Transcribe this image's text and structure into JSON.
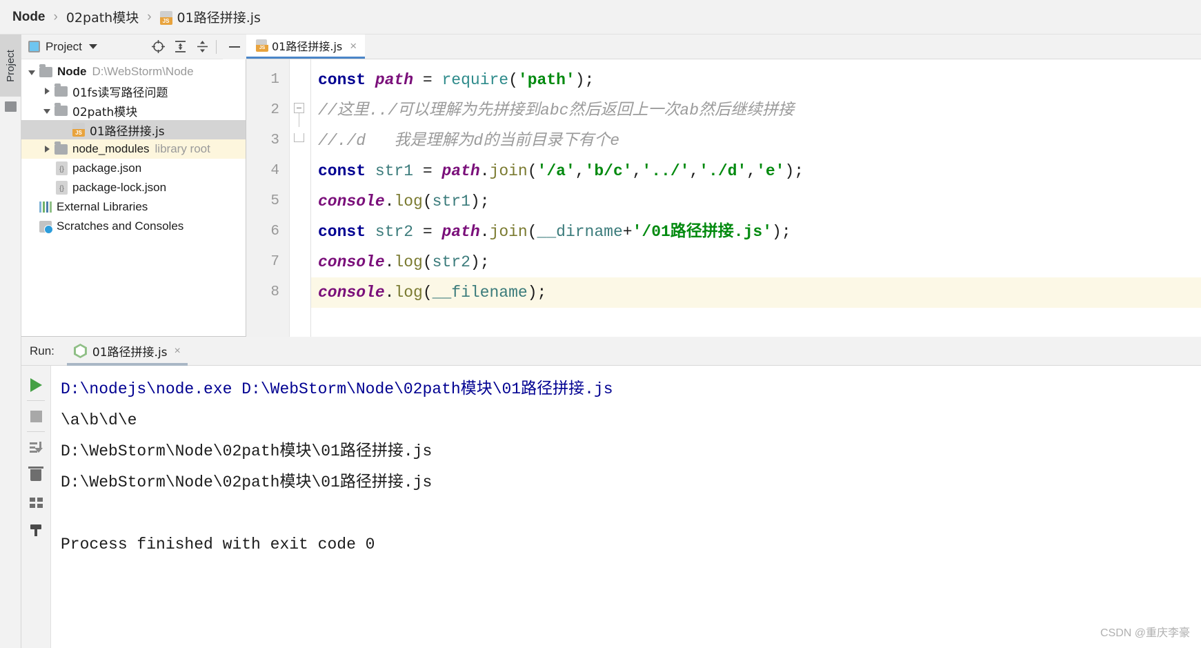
{
  "breadcrumb": {
    "items": [
      {
        "label": "Node",
        "bold": true
      },
      {
        "label": "02path模块",
        "bold": false
      },
      {
        "label": "01路径拼接.js",
        "bold": false,
        "icon": "js-file-icon"
      }
    ],
    "separator": "›"
  },
  "left_strip": {
    "project_button_label": "Project"
  },
  "project_panel": {
    "title": "Project",
    "header_icons": [
      "locate-target-icon",
      "expand-all-icon",
      "collapse-all-icon",
      "gear-icon",
      "minimize-icon"
    ],
    "tree": [
      {
        "label": "Node",
        "sub": "D:\\WebStorm\\Node",
        "icon": "folder-icon",
        "state": "expanded",
        "indent": 0,
        "bold": true
      },
      {
        "label": "01fs读写路径问题",
        "sub": "",
        "icon": "folder-icon",
        "state": "collapsed",
        "indent": 1,
        "bold": false
      },
      {
        "label": "02path模块",
        "sub": "",
        "icon": "folder-icon",
        "state": "expanded",
        "indent": 1,
        "bold": false
      },
      {
        "label": "01路径拼接.js",
        "sub": "",
        "icon": "js-file-icon",
        "state": "leaf",
        "indent": 2,
        "bold": false,
        "selected": true
      },
      {
        "label": "node_modules",
        "sub": "library root",
        "icon": "folder-icon",
        "state": "collapsed",
        "indent": 1,
        "bold": false,
        "highlight": true
      },
      {
        "label": "package.json",
        "sub": "",
        "icon": "json-file-icon",
        "state": "leaf",
        "indent": 1,
        "bold": false
      },
      {
        "label": "package-lock.json",
        "sub": "",
        "icon": "json-file-icon",
        "state": "leaf",
        "indent": 1,
        "bold": false
      },
      {
        "label": "External Libraries",
        "sub": "",
        "icon": "library-icon",
        "state": "leaf",
        "indent": 0,
        "bold": false
      },
      {
        "label": "Scratches and Consoles",
        "sub": "",
        "icon": "scratches-icon",
        "state": "leaf",
        "indent": 0,
        "bold": false
      }
    ]
  },
  "editor": {
    "tab": {
      "label": "01路径拼接.js",
      "close": "×",
      "icon": "js-file-icon"
    },
    "line_numbers": [
      "1",
      "2",
      "3",
      "4",
      "5",
      "6",
      "7",
      "8"
    ],
    "highlighted_line": 8,
    "lines": [
      {
        "n": 1,
        "tokens": [
          {
            "t": "const",
            "c": "kw"
          },
          {
            "t": " ",
            "c": "punc"
          },
          {
            "t": "path",
            "c": "obj"
          },
          {
            "t": " ",
            "c": "punc"
          },
          {
            "t": "=",
            "c": "punc"
          },
          {
            "t": " ",
            "c": "punc"
          },
          {
            "t": "require",
            "c": "fnc"
          },
          {
            "t": "(",
            "c": "punc"
          },
          {
            "t": "'path'",
            "c": "str"
          },
          {
            "t": ");",
            "c": "punc"
          }
        ]
      },
      {
        "n": 2,
        "fold": "start",
        "tokens": [
          {
            "t": "//这里../可以理解为先拼接到abc然后返回上一次ab然后继续拼接",
            "c": "cmt"
          }
        ]
      },
      {
        "n": 3,
        "fold": "end",
        "tokens": [
          {
            "t": "//./d   我是理解为d的当前目录下有个e",
            "c": "cmt"
          }
        ]
      },
      {
        "n": 4,
        "tokens": [
          {
            "t": "const",
            "c": "kw"
          },
          {
            "t": " ",
            "c": "punc"
          },
          {
            "t": "str1",
            "c": "var"
          },
          {
            "t": " ",
            "c": "punc"
          },
          {
            "t": "=",
            "c": "punc"
          },
          {
            "t": " ",
            "c": "punc"
          },
          {
            "t": "path",
            "c": "obj"
          },
          {
            "t": ".",
            "c": "punc"
          },
          {
            "t": "join",
            "c": "fn"
          },
          {
            "t": "(",
            "c": "punc"
          },
          {
            "t": "'/a'",
            "c": "str"
          },
          {
            "t": ",",
            "c": "punc"
          },
          {
            "t": "'b/c'",
            "c": "str"
          },
          {
            "t": ",",
            "c": "punc"
          },
          {
            "t": "'../'",
            "c": "str"
          },
          {
            "t": ",",
            "c": "punc"
          },
          {
            "t": "'./d'",
            "c": "str"
          },
          {
            "t": ",",
            "c": "punc"
          },
          {
            "t": "'e'",
            "c": "str"
          },
          {
            "t": ");",
            "c": "punc"
          }
        ]
      },
      {
        "n": 5,
        "tokens": [
          {
            "t": "console",
            "c": "obj"
          },
          {
            "t": ".",
            "c": "punc"
          },
          {
            "t": "log",
            "c": "fn"
          },
          {
            "t": "(",
            "c": "punc"
          },
          {
            "t": "str1",
            "c": "var"
          },
          {
            "t": ");",
            "c": "punc"
          }
        ]
      },
      {
        "n": 6,
        "tokens": [
          {
            "t": "const",
            "c": "kw"
          },
          {
            "t": " ",
            "c": "punc"
          },
          {
            "t": "str2",
            "c": "var"
          },
          {
            "t": " ",
            "c": "punc"
          },
          {
            "t": "=",
            "c": "punc"
          },
          {
            "t": " ",
            "c": "punc"
          },
          {
            "t": "path",
            "c": "obj"
          },
          {
            "t": ".",
            "c": "punc"
          },
          {
            "t": "join",
            "c": "fn"
          },
          {
            "t": "(",
            "c": "punc"
          },
          {
            "t": "__dirname",
            "c": "glob"
          },
          {
            "t": "+",
            "c": "punc"
          },
          {
            "t": "'/01路径拼接.js'",
            "c": "str"
          },
          {
            "t": ");",
            "c": "punc"
          }
        ]
      },
      {
        "n": 7,
        "tokens": [
          {
            "t": "console",
            "c": "obj"
          },
          {
            "t": ".",
            "c": "punc"
          },
          {
            "t": "log",
            "c": "fn"
          },
          {
            "t": "(",
            "c": "punc"
          },
          {
            "t": "str2",
            "c": "var"
          },
          {
            "t": ");",
            "c": "punc"
          }
        ]
      },
      {
        "n": 8,
        "tokens": [
          {
            "t": "console",
            "c": "obj"
          },
          {
            "t": ".",
            "c": "punc"
          },
          {
            "t": "log",
            "c": "fn"
          },
          {
            "t": "(",
            "c": "punc"
          },
          {
            "t": "__filename",
            "c": "glob"
          },
          {
            "t": ");",
            "c": "punc"
          }
        ]
      }
    ]
  },
  "run_panel": {
    "label": "Run:",
    "tab": {
      "label": "01路径拼接.js",
      "close": "×",
      "icon": "nodejs-icon"
    },
    "toolbar": [
      "run-icon",
      "stop-icon",
      "soft-wrap-icon",
      "clear-all-icon",
      "print-icon",
      "pin-icon"
    ],
    "output": [
      {
        "text": "D:\\nodejs\\node.exe D:\\WebStorm\\Node\\02path模块\\01路径拼接.js",
        "link": true
      },
      {
        "text": "\\a\\b\\d\\e",
        "link": false
      },
      {
        "text": "D:\\WebStorm\\Node\\02path模块\\01路径拼接.js",
        "link": false
      },
      {
        "text": "D:\\WebStorm\\Node\\02path模块\\01路径拼接.js",
        "link": false
      },
      {
        "text": "",
        "link": false
      },
      {
        "text": "Process finished with exit code 0",
        "link": false
      }
    ]
  },
  "watermark": "CSDN @重庆李豪",
  "colors": {
    "accent": "#4a86c8",
    "keyword": "#000091",
    "string": "#028a0f",
    "comment": "#9b9b9b",
    "object": "#7a0f7a",
    "highlight_line": "#fcf8e6",
    "selection": "#d4d4d4",
    "library_root": "#fdf6dd"
  }
}
